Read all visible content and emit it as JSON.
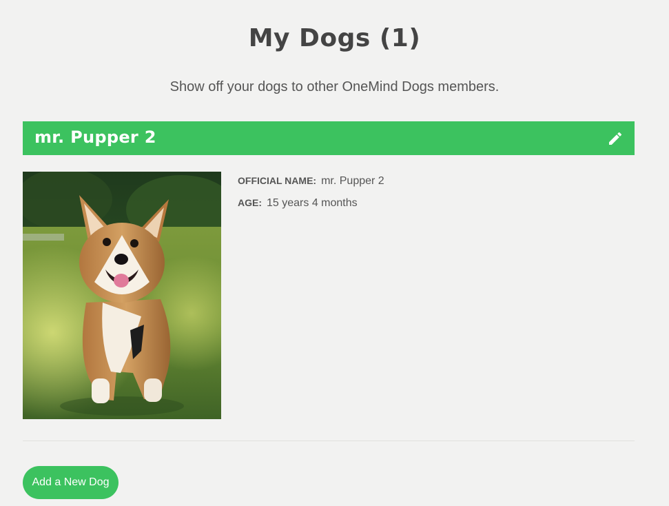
{
  "page": {
    "title": "My Dogs (1)",
    "subtitle": "Show off your dogs to other OneMind Dogs members."
  },
  "dogs": [
    {
      "name": "mr. Pupper 2",
      "edit_icon": "pencil-icon",
      "photo_alt": "corgi photo",
      "official_name_label": "OFFICIAL NAME:",
      "official_name": "mr. Pupper 2",
      "age_label": "AGE:",
      "age": "15 years 4 months"
    }
  ],
  "actions": {
    "add_dog_label": "Add a New Dog"
  },
  "colors": {
    "accent": "#3cc25f",
    "background": "#f2f2f1",
    "text": "#444444"
  }
}
